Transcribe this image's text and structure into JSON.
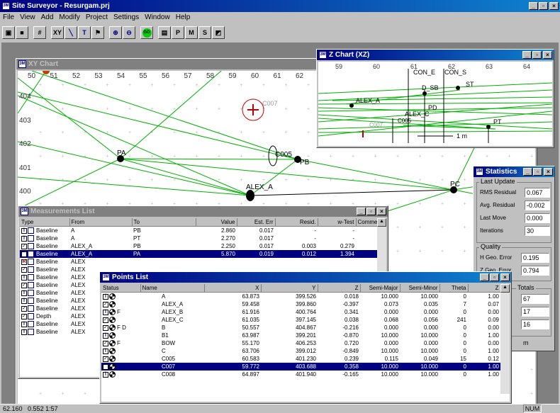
{
  "app": {
    "title": "Site Surveyor - Resurgam.prj",
    "menu": [
      "File",
      "View",
      "Add",
      "Modify",
      "Project",
      "Settings",
      "Window",
      "Help"
    ],
    "toolbar": [
      "open-icon",
      "save-icon",
      "grid-icon",
      "XY",
      "line-icon",
      "tee-icon",
      "flag-icon",
      "zoom-in-icon",
      "zoom-out-icon",
      "GO",
      "chart-icon",
      "P",
      "M",
      "S",
      "graph-icon"
    ]
  },
  "xy": {
    "title": "XY Chart",
    "xticks": [
      "50",
      "51",
      "52",
      "53",
      "54",
      "55",
      "56",
      "57",
      "58",
      "59",
      "60",
      "61",
      "62"
    ],
    "yticks": [
      "404",
      "403",
      "402",
      "401",
      "400"
    ],
    "labels": {
      "pa": "PA",
      "c005": "C005",
      "pb": "PB",
      "alex": "ALEX_A",
      "pc": "PC",
      "c007": "C007"
    }
  },
  "z": {
    "title": "Z Chart (XZ)",
    "xticks": [
      "59",
      "60",
      "61",
      "62",
      "63",
      "64"
    ],
    "labels": [
      "CON_E",
      "CON_S",
      "D_SB",
      "ST",
      "ALEX_A",
      "PD",
      "ALEX_C",
      "C005",
      "C007",
      "PT"
    ],
    "scale": "1 m"
  },
  "stats": {
    "title": "Statistics",
    "group1": "Last Update",
    "rows1": [
      {
        "label": "RMS Residual",
        "value": "0.067"
      },
      {
        "label": "Avg. Residual",
        "value": "-0.002"
      },
      {
        "label": "Last Move",
        "value": "0.000"
      },
      {
        "label": "Iterations",
        "value": "30"
      }
    ],
    "group2": "Quality",
    "rows2": [
      {
        "label": "H Geo. Error",
        "value": "0.195"
      },
      {
        "label": "Z Geo. Error",
        "value": "0.794"
      }
    ],
    "group3": "Totals",
    "totals": [
      "67",
      "17",
      "16"
    ],
    "m": "m"
  },
  "meas": {
    "title": "Measurements List",
    "headers": [
      "Type",
      "From",
      "To",
      "Value",
      "Est. Err",
      "Resid.",
      "w-Test",
      "Comme"
    ],
    "rows": [
      {
        "s": "i",
        "type": "Baseline",
        "from": "A",
        "to": "PB",
        "value": "2.860",
        "err": "0.017",
        "resid": "-",
        "wtest": "-"
      },
      {
        "s": "i",
        "type": "Baseline",
        "from": "A",
        "to": "PT",
        "value": "2.270",
        "err": "0.017",
        "resid": "-",
        "wtest": "-"
      },
      {
        "s": "c",
        "type": "Baseline",
        "from": "ALEX_A",
        "to": "PB",
        "value": "2.250",
        "err": "0.017",
        "resid": "0.003",
        "wtest": "0.279"
      },
      {
        "s": "c",
        "type": "Baseline",
        "from": "ALEX_A",
        "to": "PA",
        "value": "5.870",
        "err": "0.019",
        "resid": "0.012",
        "wtest": "1.394",
        "sel": true
      },
      {
        "s": "R",
        "type": "Baseline",
        "from": "ALEX",
        "to": "",
        "value": "",
        "err": "",
        "resid": "",
        "wtest": ""
      },
      {
        "s": "c",
        "type": "Baseline",
        "from": "ALEX",
        "to": "",
        "value": "",
        "err": "",
        "resid": "",
        "wtest": ""
      },
      {
        "s": "i",
        "type": "Baseline",
        "from": "ALEX",
        "to": "",
        "value": "",
        "err": "",
        "resid": "",
        "wtest": ""
      },
      {
        "s": "c",
        "type": "Baseline",
        "from": "ALEX",
        "to": "",
        "value": "",
        "err": "",
        "resid": "",
        "wtest": ""
      },
      {
        "s": "i",
        "type": "Baseline",
        "from": "ALEX",
        "to": "",
        "value": "",
        "err": "",
        "resid": "",
        "wtest": ""
      },
      {
        "s": "i",
        "type": "Baseline",
        "from": "ALEX",
        "to": "",
        "value": "",
        "err": "",
        "resid": "",
        "wtest": ""
      },
      {
        "s": "c",
        "type": "Baseline",
        "from": "ALEX",
        "to": "",
        "value": "",
        "err": "",
        "resid": "",
        "wtest": ""
      },
      {
        "s": "c",
        "type": "Depth",
        "from": "ALEX",
        "to": "",
        "value": "",
        "err": "",
        "resid": "",
        "wtest": ""
      },
      {
        "s": "i",
        "type": "Baseline",
        "from": "ALEX",
        "to": "",
        "value": "",
        "err": "",
        "resid": "",
        "wtest": ""
      },
      {
        "s": "i",
        "type": "Baseline",
        "from": "ALEX",
        "to": "",
        "value": "",
        "err": "",
        "resid": "",
        "wtest": ""
      }
    ]
  },
  "points": {
    "title": "Points List",
    "headers": [
      "Status",
      "Name",
      "X",
      "Y",
      "Z",
      "Semi-Major",
      "Semi-Minor",
      "Theta",
      "Z"
    ],
    "rows": [
      {
        "st": "i",
        "f": "",
        "name": "A",
        "x": "63.873",
        "y": "399.526",
        "z": "0.018",
        "maj": "10.000",
        "min": "10.000",
        "th": "0",
        "z2": "1.00"
      },
      {
        "st": "c",
        "f": "",
        "name": "ALEX_A",
        "x": "59.458",
        "y": "399.860",
        "z": "-0.397",
        "maj": "0.073",
        "min": "0.035",
        "th": "7",
        "z2": "0.07"
      },
      {
        "st": "i",
        "f": "F",
        "name": "ALEX_B",
        "x": "61.916",
        "y": "400.764",
        "z": "0.341",
        "maj": "0.000",
        "min": "0.000",
        "th": "0",
        "z2": "0.00"
      },
      {
        "st": "c",
        "f": "",
        "name": "ALEX_C",
        "x": "61.035",
        "y": "397.145",
        "z": "0.038",
        "maj": "0.068",
        "min": "0.056",
        "th": "241",
        "z2": "0.09"
      },
      {
        "st": "c",
        "f": "F D",
        "name": "B",
        "x": "50.557",
        "y": "404.867",
        "z": "-0.216",
        "maj": "0.000",
        "min": "0.000",
        "th": "0",
        "z2": "0.00"
      },
      {
        "st": "i",
        "f": "",
        "name": "B1",
        "x": "63.987",
        "y": "399.201",
        "z": "-0.870",
        "maj": "10.000",
        "min": "10.000",
        "th": "0",
        "z2": "1.00"
      },
      {
        "st": "c",
        "f": "F",
        "name": "BOW",
        "x": "55.170",
        "y": "406.253",
        "z": "0.720",
        "maj": "0.000",
        "min": "0.000",
        "th": "0",
        "z2": "0.00"
      },
      {
        "st": "i",
        "f": "",
        "name": "C",
        "x": "63.706",
        "y": "399.012",
        "z": "-0.849",
        "maj": "10.000",
        "min": "10.000",
        "th": "0",
        "z2": "1.00"
      },
      {
        "st": "c",
        "f": "",
        "name": "C005",
        "x": "60.583",
        "y": "401.230",
        "z": "0.239",
        "maj": "0.115",
        "min": "0.049",
        "th": "15",
        "z2": "0.12"
      },
      {
        "st": "x",
        "f": "",
        "name": "C007",
        "x": "59.772",
        "y": "403.688",
        "z": "0.358",
        "maj": "10.000",
        "min": "10.000",
        "th": "0",
        "z2": "1.00",
        "sel": true
      },
      {
        "st": "i",
        "f": "",
        "name": "C008",
        "x": "64.897",
        "y": "401.940",
        "z": "-0.165",
        "maj": "10.000",
        "min": "10.000",
        "th": "0",
        "z2": "1.00"
      }
    ]
  },
  "status": {
    "coords": "62.160",
    "z": "0.552",
    "time": "1:57",
    "num": "NUM"
  },
  "colors": {
    "baseline": "#00c000",
    "selection": "#000080"
  }
}
